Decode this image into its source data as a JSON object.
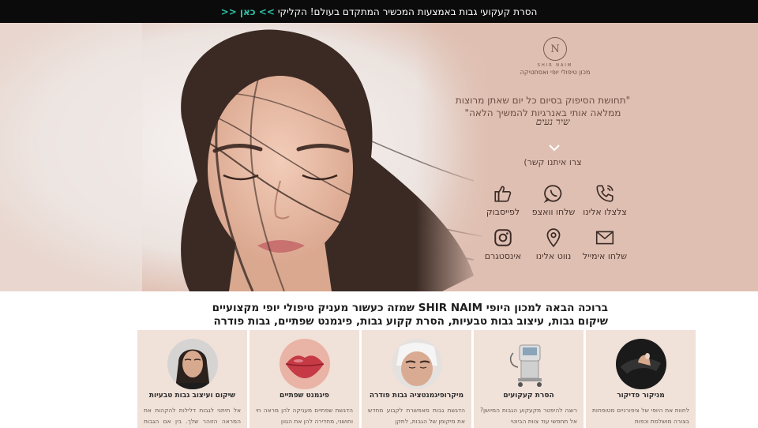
{
  "announcement": {
    "text": "הסרת קעקועי גבות באמצעות המכשיר המתקדם בעולם! הקליקי",
    "link": ">> כאן <<"
  },
  "hero": {
    "logo_name": "SHIR NAIM",
    "logo_subtitle": "מכון טיפולי יופי ואסתטיקה",
    "quote_line1": "\"תחושת הסיפוק בסיום כל יום שאתן מרוצות",
    "quote_line2": "ממלאה אותי באנרגיות להמשיך הלאה\"",
    "signature": "שיר נעים",
    "contact_title": "צרו איתנו קשר)",
    "contacts": [
      {
        "icon": "phone-icon",
        "label": "צלצלו אלינו"
      },
      {
        "icon": "whatsapp-icon",
        "label": "שלחו וואצפ"
      },
      {
        "icon": "facebook-like-icon",
        "label": "לפייסבוק"
      },
      {
        "icon": "email-icon",
        "label": "שלחו אימייל"
      },
      {
        "icon": "location-pin-icon",
        "label": "נווט אלינו"
      },
      {
        "icon": "instagram-icon",
        "label": "אינסטגרם"
      }
    ]
  },
  "headline": {
    "line1": "ברוכה הבאה למכון היופי SHIR NAIM שמזה כעשור מעניק טיפולי יופי מקצועיים",
    "line2": "שיקום גבות, עיצוב גבות טבעיות, הסרת קקוע גבות, פיגמנט שפתיים, גבות פודרה"
  },
  "cards": [
    {
      "title": "שיקום ועיצוב גבות טבעיות",
      "text": "אל תיתני לגבות דלילות להקהות את המראה הזוהר שלך. בין אם הגבות שלך"
    },
    {
      "title": "פיגמנט שפתיים",
      "text": "הדגשת שפתיים מעניקה להן מראה חי וחושני, מחדירה להן את הגוון"
    },
    {
      "title": "מיקרופיגמנטציה גבות פודרה",
      "text": "הדגשת גבות מאפשרת לקבוע מחדש את מיקומן של הגבות, לתקן"
    },
    {
      "title": "הסרת קעקועים",
      "text": "רוצה להיפטר מקעקוע הגבות המיושן? אל תחפשי עוד צוות הביוטי"
    },
    {
      "title": "מניקור פדיקור",
      "text": "לחוות את היופי של ציפורניים מטופחות בצורה מושלמת וכפות"
    }
  ],
  "colors": {
    "topbar": "#0b0b0b",
    "accent_link": "#2fc1a5",
    "hero_bg": "#dfbfb1",
    "card_bg": "#f0e1d9"
  }
}
